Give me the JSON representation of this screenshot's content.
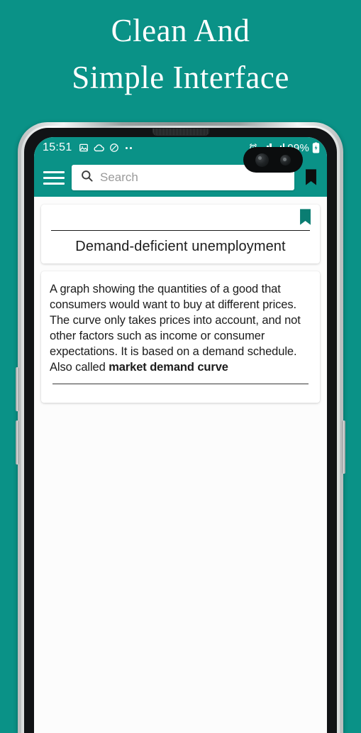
{
  "promo": {
    "headline_line1": "Clean And",
    "headline_line2": "Simple Interface",
    "background_color": "#0a9287",
    "headline_color": "#ffffff"
  },
  "phone": {
    "status_bar": {
      "time": "15:51",
      "left_icons": [
        "image-icon",
        "cloud-icon",
        "shield-icon",
        "more-dots-icon"
      ],
      "alarm_icon": "alarm-icon",
      "signal_icon": "signal-bars-icon",
      "battery_percent": "99%",
      "battery_icon": "battery-charging-icon",
      "background_color": "#0a9287"
    },
    "app_bar": {
      "menu_icon": "hamburger-menu-icon",
      "search_icon": "search-icon",
      "search_value": "",
      "search_placeholder": "Search",
      "bookmark_icon": "bookmark-icon",
      "background_color": "#0a9287"
    },
    "content": {
      "title_card": {
        "bookmark_icon": "bookmark-filled-icon",
        "bookmark_color": "#0a7d72",
        "title": "Demand-deficient unemployment"
      },
      "definition_card": {
        "body": "A graph showing the quantities of a good that consumers would want to buy at different prices. The curve only takes prices into account, and not other factors such as income or consumer expectations. It is based on a demand schedule. Also called ",
        "bold_term": "market demand curve"
      }
    }
  }
}
